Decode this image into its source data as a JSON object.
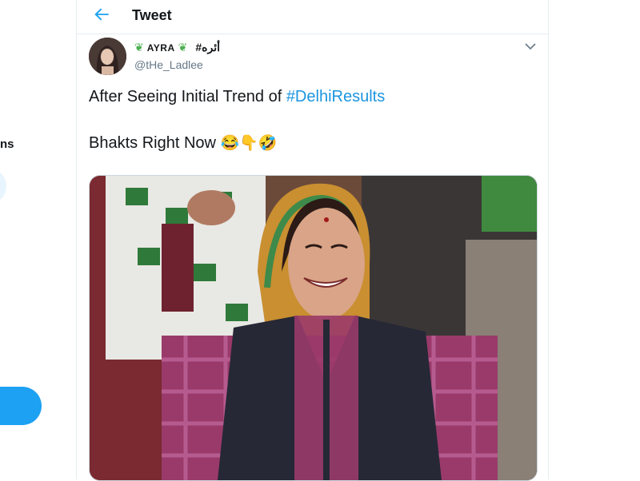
{
  "sidebar": {
    "partial_label": "ns"
  },
  "header": {
    "title": "Tweet",
    "back_icon": "arrow-left-icon"
  },
  "tweet": {
    "author": {
      "display_name": "AYRA",
      "display_name_extra": "#أئره",
      "handle": "@tHe_Ladlee",
      "badge_icon": "leaf-icon"
    },
    "text_line1_prefix": "After Seeing Initial Trend of ",
    "text_line1_hashtag": "#DelhiResults",
    "text_line2": "Bhakts Right Now",
    "emojis": "😂👇🤣",
    "menu_icon": "chevron-down-icon"
  },
  "colors": {
    "accent": "#1da1f2",
    "hashtag": "#1b95e0",
    "border": "#e6ecf0"
  }
}
